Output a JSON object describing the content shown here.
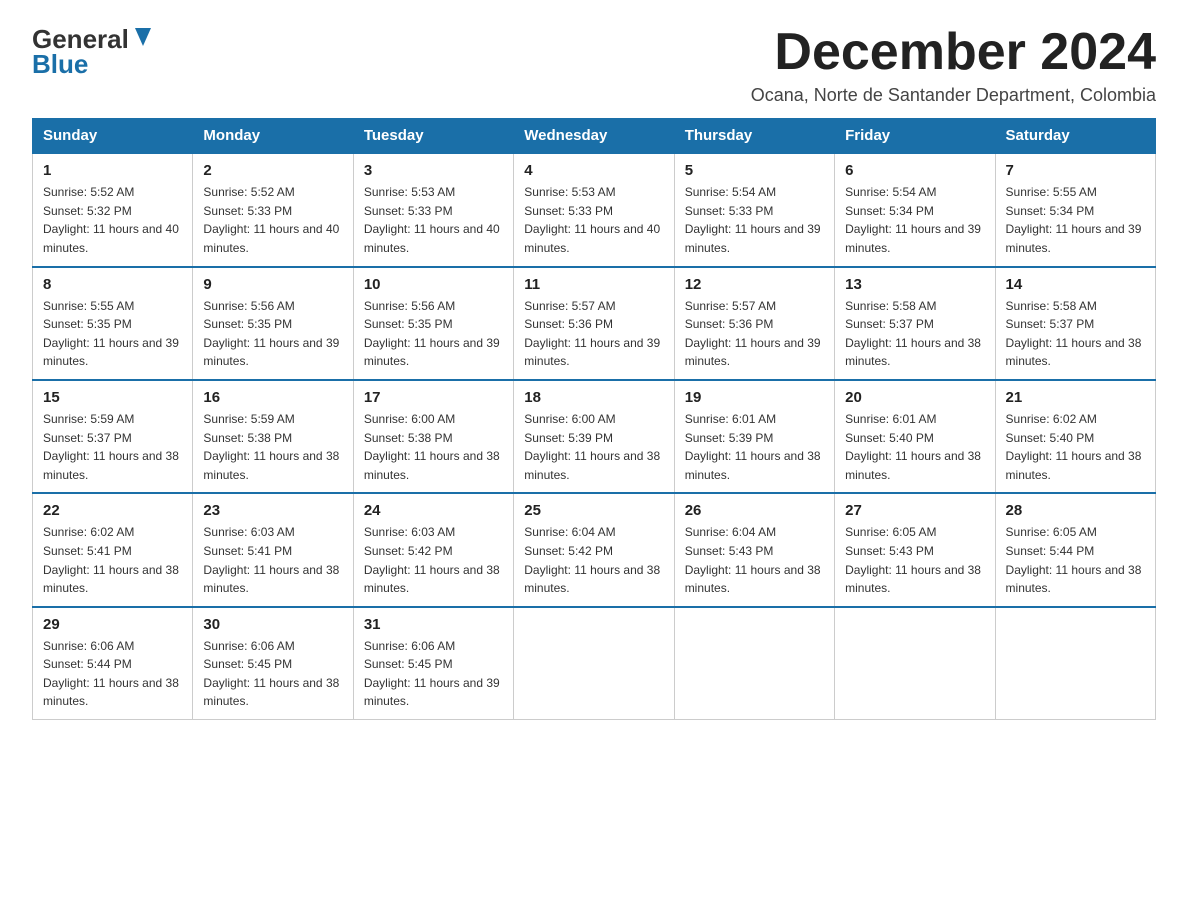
{
  "header": {
    "logo_line1": "General",
    "logo_line2": "Blue",
    "month_title": "December 2024",
    "subtitle": "Ocana, Norte de Santander Department, Colombia"
  },
  "weekdays": [
    "Sunday",
    "Monday",
    "Tuesday",
    "Wednesday",
    "Thursday",
    "Friday",
    "Saturday"
  ],
  "weeks": [
    [
      {
        "day": "1",
        "sunrise": "5:52 AM",
        "sunset": "5:32 PM",
        "daylight": "11 hours and 40 minutes."
      },
      {
        "day": "2",
        "sunrise": "5:52 AM",
        "sunset": "5:33 PM",
        "daylight": "11 hours and 40 minutes."
      },
      {
        "day": "3",
        "sunrise": "5:53 AM",
        "sunset": "5:33 PM",
        "daylight": "11 hours and 40 minutes."
      },
      {
        "day": "4",
        "sunrise": "5:53 AM",
        "sunset": "5:33 PM",
        "daylight": "11 hours and 40 minutes."
      },
      {
        "day": "5",
        "sunrise": "5:54 AM",
        "sunset": "5:33 PM",
        "daylight": "11 hours and 39 minutes."
      },
      {
        "day": "6",
        "sunrise": "5:54 AM",
        "sunset": "5:34 PM",
        "daylight": "11 hours and 39 minutes."
      },
      {
        "day": "7",
        "sunrise": "5:55 AM",
        "sunset": "5:34 PM",
        "daylight": "11 hours and 39 minutes."
      }
    ],
    [
      {
        "day": "8",
        "sunrise": "5:55 AM",
        "sunset": "5:35 PM",
        "daylight": "11 hours and 39 minutes."
      },
      {
        "day": "9",
        "sunrise": "5:56 AM",
        "sunset": "5:35 PM",
        "daylight": "11 hours and 39 minutes."
      },
      {
        "day": "10",
        "sunrise": "5:56 AM",
        "sunset": "5:35 PM",
        "daylight": "11 hours and 39 minutes."
      },
      {
        "day": "11",
        "sunrise": "5:57 AM",
        "sunset": "5:36 PM",
        "daylight": "11 hours and 39 minutes."
      },
      {
        "day": "12",
        "sunrise": "5:57 AM",
        "sunset": "5:36 PM",
        "daylight": "11 hours and 39 minutes."
      },
      {
        "day": "13",
        "sunrise": "5:58 AM",
        "sunset": "5:37 PM",
        "daylight": "11 hours and 38 minutes."
      },
      {
        "day": "14",
        "sunrise": "5:58 AM",
        "sunset": "5:37 PM",
        "daylight": "11 hours and 38 minutes."
      }
    ],
    [
      {
        "day": "15",
        "sunrise": "5:59 AM",
        "sunset": "5:37 PM",
        "daylight": "11 hours and 38 minutes."
      },
      {
        "day": "16",
        "sunrise": "5:59 AM",
        "sunset": "5:38 PM",
        "daylight": "11 hours and 38 minutes."
      },
      {
        "day": "17",
        "sunrise": "6:00 AM",
        "sunset": "5:38 PM",
        "daylight": "11 hours and 38 minutes."
      },
      {
        "day": "18",
        "sunrise": "6:00 AM",
        "sunset": "5:39 PM",
        "daylight": "11 hours and 38 minutes."
      },
      {
        "day": "19",
        "sunrise": "6:01 AM",
        "sunset": "5:39 PM",
        "daylight": "11 hours and 38 minutes."
      },
      {
        "day": "20",
        "sunrise": "6:01 AM",
        "sunset": "5:40 PM",
        "daylight": "11 hours and 38 minutes."
      },
      {
        "day": "21",
        "sunrise": "6:02 AM",
        "sunset": "5:40 PM",
        "daylight": "11 hours and 38 minutes."
      }
    ],
    [
      {
        "day": "22",
        "sunrise": "6:02 AM",
        "sunset": "5:41 PM",
        "daylight": "11 hours and 38 minutes."
      },
      {
        "day": "23",
        "sunrise": "6:03 AM",
        "sunset": "5:41 PM",
        "daylight": "11 hours and 38 minutes."
      },
      {
        "day": "24",
        "sunrise": "6:03 AM",
        "sunset": "5:42 PM",
        "daylight": "11 hours and 38 minutes."
      },
      {
        "day": "25",
        "sunrise": "6:04 AM",
        "sunset": "5:42 PM",
        "daylight": "11 hours and 38 minutes."
      },
      {
        "day": "26",
        "sunrise": "6:04 AM",
        "sunset": "5:43 PM",
        "daylight": "11 hours and 38 minutes."
      },
      {
        "day": "27",
        "sunrise": "6:05 AM",
        "sunset": "5:43 PM",
        "daylight": "11 hours and 38 minutes."
      },
      {
        "day": "28",
        "sunrise": "6:05 AM",
        "sunset": "5:44 PM",
        "daylight": "11 hours and 38 minutes."
      }
    ],
    [
      {
        "day": "29",
        "sunrise": "6:06 AM",
        "sunset": "5:44 PM",
        "daylight": "11 hours and 38 minutes."
      },
      {
        "day": "30",
        "sunrise": "6:06 AM",
        "sunset": "5:45 PM",
        "daylight": "11 hours and 38 minutes."
      },
      {
        "day": "31",
        "sunrise": "6:06 AM",
        "sunset": "5:45 PM",
        "daylight": "11 hours and 39 minutes."
      },
      null,
      null,
      null,
      null
    ]
  ]
}
